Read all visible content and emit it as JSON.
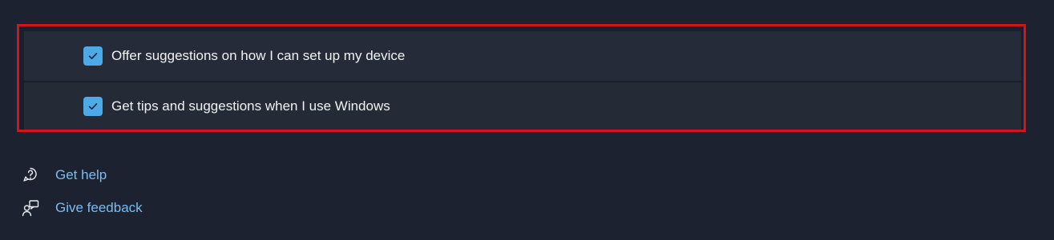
{
  "options": [
    {
      "label": "Offer suggestions on how I can set up my device",
      "checked": true
    },
    {
      "label": "Get tips and suggestions when I use Windows",
      "checked": true
    }
  ],
  "links": {
    "help": {
      "label": "Get help",
      "icon": "help-chat-icon"
    },
    "feedback": {
      "label": "Give feedback",
      "icon": "feedback-icon"
    }
  },
  "colors": {
    "background": "#1d2230",
    "row": "#262b39",
    "checkbox_accent": "#4ea9e8",
    "highlight_border": "#d4141c",
    "link": "#7cbcf0"
  }
}
